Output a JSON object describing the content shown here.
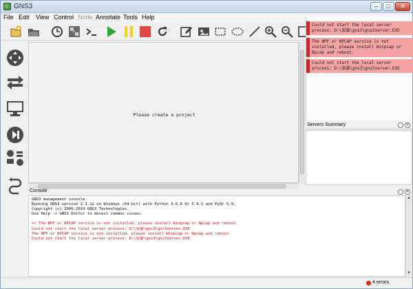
{
  "window": {
    "title": "GNS3"
  },
  "menu": [
    "File",
    "Edit",
    "View",
    "Control",
    "Node",
    "Annotate",
    "Tools",
    "Help"
  ],
  "menu_disabled": [
    "Node"
  ],
  "toolbar": {
    "icons": [
      "new-project-icon",
      "open-project-icon",
      "snapshot-clock-icon",
      "show-interface-labels-icon",
      "console-all-icon",
      "start-all-icon",
      "suspend-all-icon",
      "stop-all-icon",
      "reload-all-icon",
      "add-note-icon",
      "insert-image-icon",
      "draw-rectangle-icon",
      "draw-ellipse-icon",
      "draw-line-icon",
      "zoom-in-icon",
      "zoom-out-icon",
      "screenshot-icon"
    ],
    "colors": {
      "start": "#2ea43a",
      "suspend": "#f2d31b",
      "stop": "#e04848",
      "icon": "#3a3a3a"
    }
  },
  "devices_panel": {
    "items": [
      "routers-icon",
      "switches-icon",
      "end-devices-icon",
      "security-devices-icon",
      "all-devices-icon",
      "add-link-icon"
    ]
  },
  "canvas": {
    "message": "Please create a project"
  },
  "notifications": [
    {
      "lines": [
        "Could not start the local server",
        "process: D:\\安装\\gns3\\gns3server.EXE"
      ]
    },
    {
      "lines": [
        "The NPF or NPCAP service is not",
        "installed, please install Winpcap or",
        "Npcap and reboot."
      ]
    },
    {
      "lines": [
        "Could not start the local server",
        "process: D:\\安装\\gns3\\gns3server.EXE"
      ]
    }
  ],
  "servers_summary": {
    "title": "Servers Summary"
  },
  "console": {
    "title": "Console",
    "lines": [
      {
        "text": "GNS3 management console.",
        "type": "info"
      },
      {
        "text": "Running GNS3 version 2.1.12 on Windows (64-bit) with Python 3.6.6 Qt 5.9.1 and PyQt 5.9.",
        "type": "info"
      },
      {
        "text": "Copyright (c) 2006-2019 GNS3 Technologies.",
        "type": "info"
      },
      {
        "text": "Use Help -> GNS3 Doctor to detect common issues.",
        "type": "info"
      },
      {
        "text": "",
        "type": "info"
      },
      {
        "text": "=> The NPF or NPCAP service is not installed, please install Winpcap or Npcap and reboot.",
        "type": "error"
      },
      {
        "text": "Could not start the local server process: D:\\安装\\gns3\\gns3server.EXE",
        "type": "error"
      },
      {
        "text": "The NPF or NPCAP service is not installed, please install Winpcap or Npcap and reboot.",
        "type": "error"
      },
      {
        "text": "Could not start the local server process: D:\\安装\\gns3\\gns3server.EXE",
        "type": "error"
      }
    ]
  },
  "status": {
    "errors": "4 errors"
  }
}
